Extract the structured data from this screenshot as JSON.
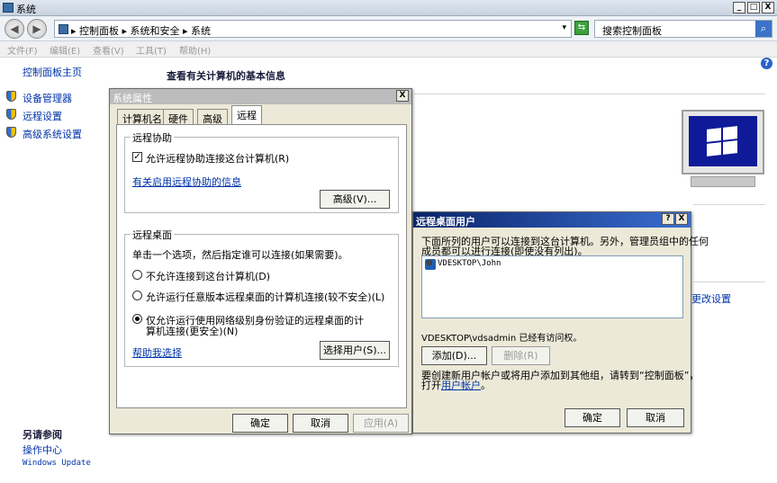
{
  "window": {
    "title": "系统",
    "min_label": "_",
    "max_label": "□",
    "close_label": "X"
  },
  "address": {
    "back_label": "◀",
    "forward_label": "▶",
    "crumbs": "▸ 控制面板 ▸ 系统和安全 ▸ 系统",
    "dropdown_glyph": "▾",
    "refresh_glyph": "⇆",
    "search_placeholder": "搜索控制面板"
  },
  "menu": [
    "文件(F)",
    "编辑(E)",
    "查看(V)",
    "工具(T)",
    "帮助(H)"
  ],
  "left_pane": {
    "home": "控制面板主页",
    "links": [
      "设备管理器",
      "远程设置",
      "高级系统设置"
    ],
    "see_also_title": "另请参阅",
    "see_also": [
      "操作中心",
      "Windows Update"
    ]
  },
  "main": {
    "title": "查看有关计算机的基本信息",
    "change_settings": "更改设置",
    "help_glyph": "?"
  },
  "sys_props": {
    "title": "系统属性",
    "close_label": "X",
    "tabs": [
      "计算机名",
      "硬件",
      "高级",
      "远程"
    ],
    "selected_tab": "远程",
    "remote_assist": {
      "group": "远程协助",
      "checkbox": "允许远程协助连接这台计算机(R)",
      "checked": true,
      "link": "有关启用远程协助的信息",
      "advanced_btn": "高级(V)..."
    },
    "remote_desktop": {
      "group": "远程桌面",
      "desc": "单击一个选项，然后指定谁可以连接(如果需要)。",
      "opt1": "不允许连接到这台计算机(D)",
      "opt2": "允许运行任意版本远程桌面的计算机连接(较不安全)(L)",
      "opt3_line1": "仅允许运行使用网络级别身份验证的远程桌面的计",
      "opt3_line2": "算机连接(更安全)(N)",
      "selected": 3,
      "help_link": "帮助我选择",
      "select_users_btn": "选择用户(S)..."
    },
    "ok": "确定",
    "cancel": "取消",
    "apply": "应用(A)"
  },
  "rdu": {
    "title": "远程桌面用户",
    "help_label": "?",
    "close_label": "X",
    "desc_line1": "下面所列的用户可以连接到这台计算机。另外，管理员组中的任何",
    "desc_line2": "成员都可以进行连接(即使没有列出)。",
    "users": [
      "VDESKTOP\\John"
    ],
    "access_note": "VDESKTOP\\vdsadmin 已经有访问权。",
    "add_btn": "添加(D)...",
    "remove_btn": "删除(R)",
    "footer_line1": "要创建新用户帐户或将用户添加到其他组，请转到“控制面板”，",
    "footer_prefix": "打开",
    "footer_link": "用户帐户",
    "footer_suffix": "。",
    "ok": "确定",
    "cancel": "取消"
  }
}
